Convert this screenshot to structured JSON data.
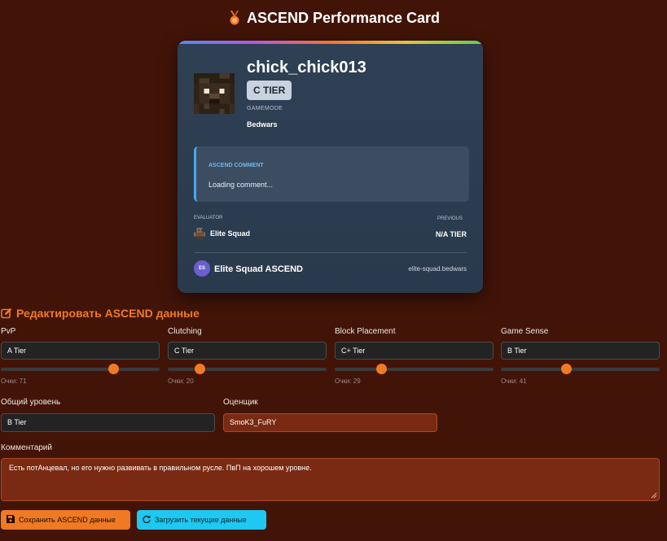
{
  "page": {
    "title": "ASCEND Performance Card"
  },
  "card": {
    "player_name": "chick_chick013",
    "tier": "C TIER",
    "gamemode_label": "GAMEMODE",
    "gamemode": "Bedwars",
    "comment_label": "ASCEND COMMENT",
    "comment": "Loading comment...",
    "evaluator_label": "EVALUATOR",
    "evaluator": "Elite Squad",
    "previous_label": "PREVIOUS",
    "previous": "N/A TIER",
    "brand_badge": "ES",
    "brand": "Elite Squad ASCEND",
    "domain": "elite-squad.bedwars"
  },
  "editor": {
    "title": "Редактировать ASCEND данные",
    "skills": [
      {
        "label": "PvP",
        "value": "A Tier",
        "points_text": "Очки: 71",
        "points": 71
      },
      {
        "label": "Clutching",
        "value": "C Tier",
        "points_text": "Очки: 20",
        "points": 20
      },
      {
        "label": "Block Placement",
        "value": "C+ Tier",
        "points_text": "Очки: 29",
        "points": 29
      },
      {
        "label": "Game Sense",
        "value": "B Tier",
        "points_text": "Очки: 41",
        "points": 41
      }
    ],
    "overall_label": "Общий уровень",
    "overall_value": "B Tier",
    "evaluator_label": "Оценщик",
    "evaluator_value": "SmoK3_FuRY",
    "comment_label": "Комментарий",
    "comment_value": "Есть потАнцевал, но его нужно развивать в правильном русле. ПвП на хорошем уровне.",
    "save_button": "Сохранить ASCEND данные",
    "load_button": "Загрузить текущие данные"
  },
  "colors": {
    "background": "#421408",
    "accent": "#f07a23",
    "info": "#1ec8f0",
    "card": "#2f4055"
  }
}
